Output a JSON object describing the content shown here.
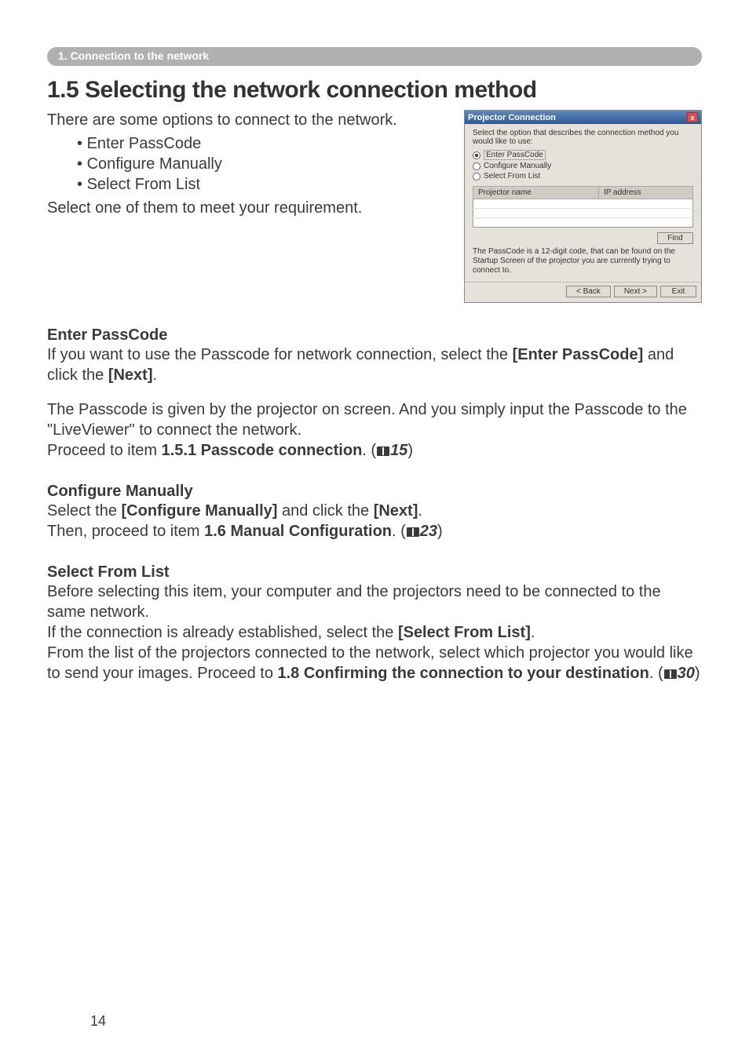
{
  "breadcrumb": "1. Connection to the network",
  "title": "1.5 Selecting the network connection method",
  "intro1": "There are some options to connect to the network.",
  "bullets": [
    "Enter PassCode",
    "Configure Manually",
    "Select From List"
  ],
  "intro2": "Select one of them to meet your requirement.",
  "sections": {
    "enter_passcode": {
      "heading": "Enter PassCode",
      "p1a": "If you want to use the Passcode for network connection, select the ",
      "p1b": "[Enter PassCode]",
      "p1c": " and click the ",
      "p1d": "[Next]",
      "p1e": ".",
      "p2": "The Passcode is given by the projector on screen. And you simply input the Passcode to the \"LiveViewer\" to connect the network.",
      "p3a": "Proceed to item ",
      "p3b": "1.5.1 Passcode connection",
      "p3c": ". (",
      "p3ref": "15",
      "p3d": ")"
    },
    "configure_manually": {
      "heading": "Configure Manually",
      "p1a": "Select the ",
      "p1b": "[Configure Manually]",
      "p1c": " and click the ",
      "p1d": "[Next]",
      "p1e": ".",
      "p2a": "Then, proceed to item ",
      "p2b": "1.6 Manual Configuration",
      "p2c": ". (",
      "p2ref": "23",
      "p2d": ")"
    },
    "select_from_list": {
      "heading": "Select From List",
      "p1": "Before selecting this item, your computer and the projectors need to be connected to the same network.",
      "p2a": "If the connection is already established, select the ",
      "p2b": "[Select From List]",
      "p2c": ".",
      "p3a": "From the list of the projectors connected to the network, select which projector you would like to send your images. Proceed to ",
      "p3b": "1.8 Confirming the connection to your destination",
      "p3c": ". (",
      "p3ref": "30",
      "p3d": ")"
    }
  },
  "dialog": {
    "title": "Projector Connection",
    "close": "x",
    "prompt": "Select the option that describes the connection method you would like to use:",
    "options": [
      {
        "label": "Enter PassCode",
        "checked": true
      },
      {
        "label": "Configure Manually",
        "checked": false
      },
      {
        "label": "Select From List",
        "checked": false
      }
    ],
    "table": {
      "col1": "Projector name",
      "col2": "IP address"
    },
    "find": "Find",
    "help": "The PassCode is a 12-digit code, that can be found on the Startup Screen of the projector you are currently trying to connect to.",
    "buttons": {
      "back": "< Back",
      "next": "Next >",
      "exit": "Exit"
    }
  },
  "page_number": "14"
}
